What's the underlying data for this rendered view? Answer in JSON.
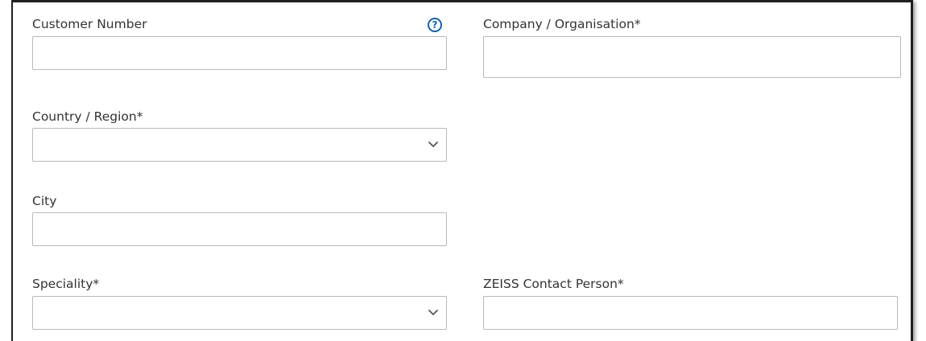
{
  "form": {
    "customer_number": {
      "label": "Customer Number",
      "value": "",
      "help_icon": "question-circle-icon",
      "help_glyph": "?"
    },
    "company": {
      "label": "Company / Organisation*",
      "value": ""
    },
    "country": {
      "label": "Country / Region*",
      "selected": "",
      "icon": "chevron-down-icon"
    },
    "city": {
      "label": "City",
      "value": ""
    },
    "speciality": {
      "label": "Speciality*",
      "selected": "",
      "icon": "chevron-down-icon"
    },
    "contact_person": {
      "label": "ZEISS Contact Person*",
      "value": ""
    }
  },
  "colors": {
    "help_icon": "#0a64b4",
    "field_border": "#b9b9b9",
    "label_text": "#333333"
  }
}
